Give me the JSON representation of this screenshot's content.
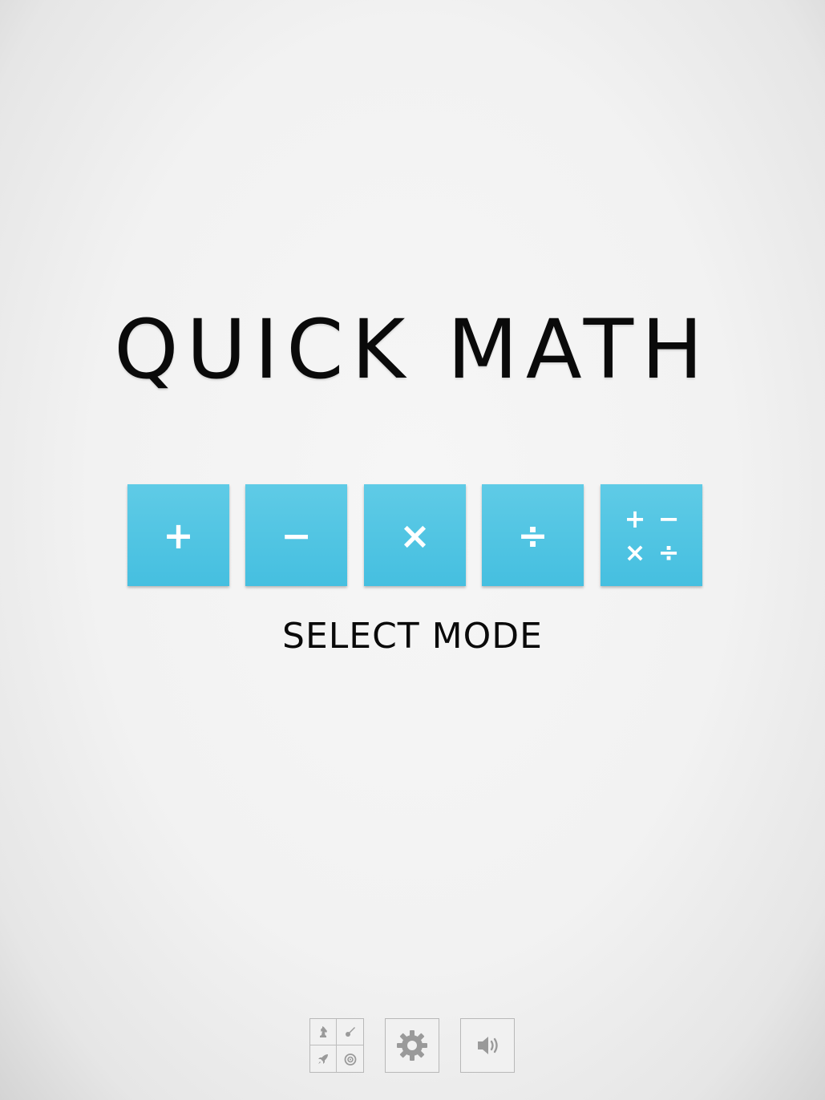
{
  "title": "QUICK MATH",
  "modes": [
    {
      "name": "addition",
      "symbol": "+"
    },
    {
      "name": "subtraction",
      "symbol": "−"
    },
    {
      "name": "multiplication",
      "symbol": "×"
    },
    {
      "name": "division",
      "symbol": "÷"
    },
    {
      "name": "mixed",
      "symbols": [
        "+",
        "−",
        "×",
        "÷"
      ]
    }
  ],
  "select_mode_label": "SELECT MODE",
  "colors": {
    "mode_button": "#4cc3e2",
    "text": "#0a0a0a",
    "icon_gray": "#9a9a9a"
  },
  "bottom_bar": {
    "icons": [
      "achievements-icon",
      "gear-icon",
      "speaker-icon"
    ]
  }
}
